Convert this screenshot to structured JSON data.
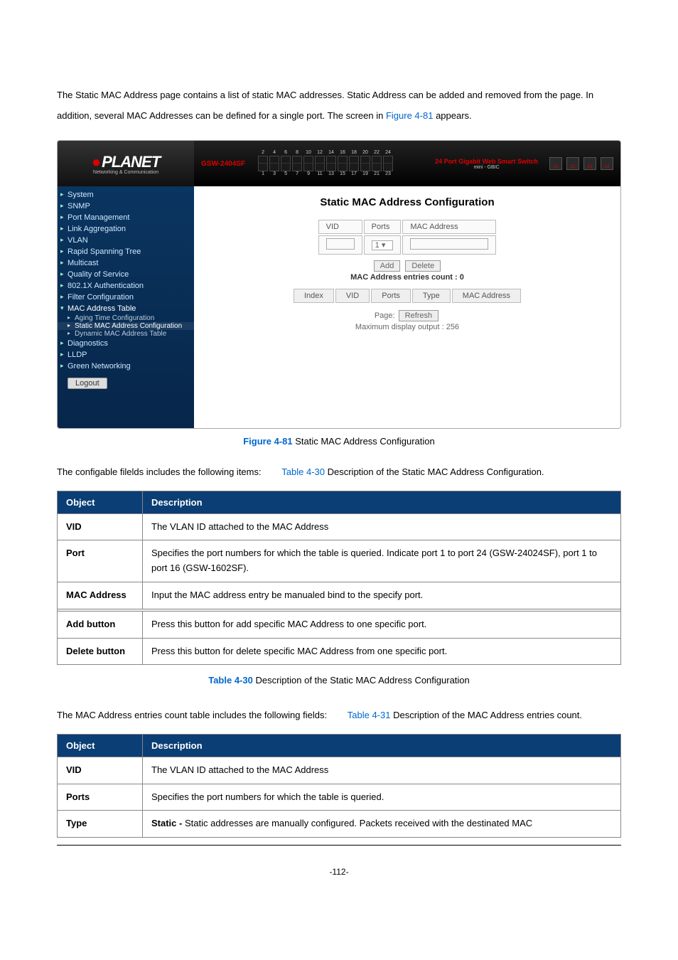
{
  "intro": {
    "text_a": "The Static MAC Address page contains a list of static MAC addresses. Static Address can be added and removed from the page. In addition, several MAC Addresses can be defined for a single port. The screen in ",
    "link": "Figure 4-81",
    "text_b": " appears."
  },
  "screenshot": {
    "brand_pre": "●",
    "brand": "PLANET",
    "brand_sub": "Networking & Communication",
    "model": "GSW-2404SF",
    "port_top_nums": [
      "2",
      "4",
      "6",
      "8",
      "10",
      "12",
      "14",
      "16",
      "18",
      "20",
      "22",
      "24"
    ],
    "port_bot_nums": [
      "1",
      "3",
      "5",
      "7",
      "9",
      "11",
      "13",
      "15",
      "17",
      "19",
      "21",
      "23"
    ],
    "right_title": "24 Port Gigabit Web Smart Switch",
    "right_sub": "mini - GBIC",
    "gbic": [
      "21",
      "22",
      "23",
      "24"
    ],
    "side_items": [
      {
        "label": "System",
        "cls": "top"
      },
      {
        "label": "SNMP",
        "cls": "top"
      },
      {
        "label": "Port Management",
        "cls": "top"
      },
      {
        "label": "Link Aggregation",
        "cls": "top"
      },
      {
        "label": "VLAN",
        "cls": "top"
      },
      {
        "label": "Rapid Spanning Tree",
        "cls": "top"
      },
      {
        "label": "Multicast",
        "cls": "top"
      },
      {
        "label": "Quality of Service",
        "cls": "top"
      },
      {
        "label": "802.1X Authentication",
        "cls": "top"
      },
      {
        "label": "Filter Configuration",
        "cls": "top"
      },
      {
        "label": "MAC Address Table",
        "cls": "top active"
      }
    ],
    "side_subs": [
      {
        "label": "Aging Time Configuration",
        "sel": false
      },
      {
        "label": "Static MAC Address Configuration",
        "sel": true
      },
      {
        "label": "Dynamic MAC Address Table",
        "sel": false
      }
    ],
    "side_items2": [
      {
        "label": "Diagnostics",
        "cls": "top"
      },
      {
        "label": "LLDP",
        "cls": "top"
      },
      {
        "label": "Green Networking",
        "cls": "top"
      }
    ],
    "logout": "Logout",
    "main": {
      "title": "Static MAC Address Configuration",
      "cols": [
        "VID",
        "Ports",
        "MAC Address"
      ],
      "port_sel": "1",
      "btn_add": "Add",
      "btn_delete": "Delete",
      "entries_label": "MAC Address entries count : 0",
      "list_cols": [
        "Index",
        "VID",
        "Ports",
        "Type",
        "MAC Address"
      ],
      "page_label": "Page:",
      "btn_refresh": "Refresh",
      "max_label": "Maximum display output : 256"
    }
  },
  "fig_caption": {
    "prefix": "Figure 4-81",
    "text": " Static MAC Address Configuration"
  },
  "config_para": {
    "a": "The configable filelds includes the following items:",
    "b": "Table 4-30",
    "c": " Description of the Static MAC Address Configuration."
  },
  "config_table": {
    "h1": "Object",
    "h2": "Description",
    "rows": [
      {
        "obj": "VID",
        "desc": "The VLAN ID attached to the MAC Address"
      },
      {
        "obj": "Port",
        "desc": "Specifies the port numbers for which the table is queried. Indicate port 1 to port 24 (GSW-24024SF), port 1 to port 16 (GSW-1602SF)."
      },
      {
        "obj": "MAC Address",
        "desc": "Input the MAC address entry be manualed bind to the specify port."
      }
    ],
    "rows_b": [
      {
        "obj": "Add button",
        "desc": "Press this button for add specific MAC Address to one specific port."
      },
      {
        "obj": "Delete button",
        "desc": "Press this button for delete specific MAC Address from one specific port."
      }
    ]
  },
  "config_tbl_caption": {
    "prefix": "Table 4-30",
    "text": " Description of the Static MAC Address Configuration"
  },
  "entries_para": {
    "a": "The MAC Address entries count table includes the following fields:",
    "b": "Table 4-31",
    "c": " Description of the MAC Address entries count."
  },
  "entries_table": {
    "h1": "Object",
    "h2": "Description",
    "rows": [
      {
        "obj": "VID",
        "desc": "The VLAN ID attached to the MAC Address"
      },
      {
        "obj": "Ports",
        "desc": "Specifies the port numbers for which the table is queried."
      },
      {
        "obj": "Type",
        "desc_pre": "Static - ",
        "desc": "Static addresses are manually configured. Packets received with the destinated MAC"
      }
    ]
  },
  "page_number": "-112-"
}
